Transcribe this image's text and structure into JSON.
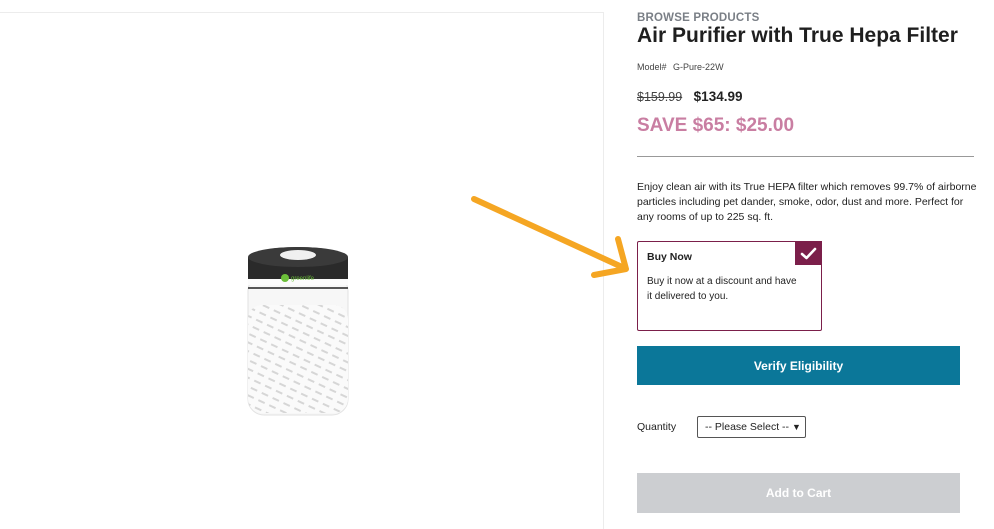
{
  "breadcrumb": "BROWSE PRODUCTS",
  "product": {
    "title": "Air Purifier with True Hepa Filter",
    "model_label": "Model#",
    "model_value": "G-Pure-22W",
    "old_price": "$159.99",
    "new_price": "$134.99",
    "save_text": "SAVE $65: $25.00",
    "description": "Enjoy clean air with its True HEPA filter which removes 99.7% of airborne particles including pet dander, smoke, odor, dust and more. Perfect for any rooms of up to 225 sq. ft.",
    "image_brand": "greenlife"
  },
  "option": {
    "title": "Buy Now",
    "description": "Buy it now at a discount and have it delivered to you.",
    "selected": true
  },
  "buttons": {
    "verify": "Verify Eligibility",
    "add_to_cart": "Add to Cart"
  },
  "quantity": {
    "label": "Quantity",
    "selected": "-- Please Select --"
  },
  "colors": {
    "accent": "#7b1f4a",
    "verify_button": "#0b7799",
    "save": "#c97ea2",
    "arrow": "#f5a623",
    "disabled_button": "#ccced1"
  }
}
